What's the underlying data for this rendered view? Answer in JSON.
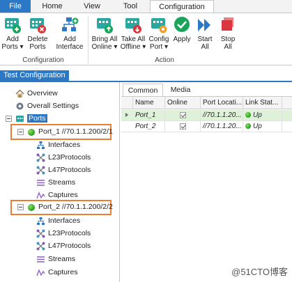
{
  "menu": {
    "file": "File",
    "home": "Home",
    "view": "View",
    "tool": "Tool",
    "configuration": "Configuration"
  },
  "ribbon": {
    "add_ports": [
      "Add",
      "Ports ▾"
    ],
    "delete_ports": [
      "Delete",
      "Ports"
    ],
    "add_interface": [
      "Add",
      "Interface"
    ],
    "bring_all_online": [
      "Bring All",
      "Online ▾"
    ],
    "take_all_offline": [
      "Take All",
      "Offline ▾"
    ],
    "config_port": [
      "Config",
      "Port ▾"
    ],
    "apply": "Apply",
    "start_all": [
      "Start",
      "All"
    ],
    "stop_all": [
      "Stop",
      "All"
    ],
    "group_configuration": "Configuration",
    "group_action": "Action"
  },
  "panel": {
    "title": "Test Configuration"
  },
  "tree": {
    "overview": "Overview",
    "overall_settings": "Overall Settings",
    "ports": "Ports",
    "port1": "Port_1 //70.1.1.200/2/1",
    "port2": "Port_2 //70.1.1.200/2/2",
    "children": [
      "Interfaces",
      "L23Protocols",
      "L47Protocols",
      "Streams",
      "Captures"
    ]
  },
  "grid": {
    "tabs": [
      "Common",
      "Media"
    ],
    "columns": [
      "Name",
      "Online",
      "Port Locati...",
      "Link Stat..."
    ],
    "rows": [
      {
        "name": "Port_1",
        "online": true,
        "location": "//70.1.1.20...",
        "link": "Up"
      },
      {
        "name": "Port_2",
        "online": true,
        "location": "//70.1.1.20...",
        "link": "Up"
      }
    ]
  },
  "watermark": "@51CTO博客",
  "colors": {
    "accent": "#2b78c6",
    "highlight": "#ed7d31",
    "online": "#1f9d1f"
  }
}
